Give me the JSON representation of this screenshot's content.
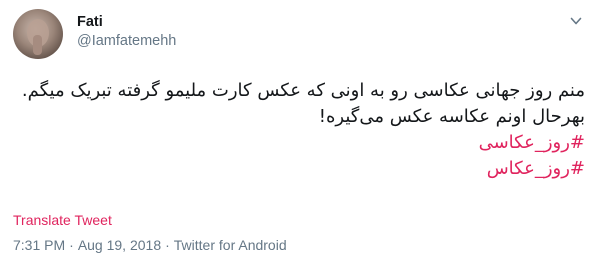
{
  "tweet": {
    "display_name": "Fati",
    "handle": "@Iamfatemehh",
    "text_lines": [
      "منم روز جهانی عکاسی رو به اونی که عکس کارت ملیمو گرفته تبریک میگم.",
      "بهرحال اونم عکاسه عکس می‌گیره!"
    ],
    "hashtags": [
      "#روز_عکاسی",
      "#روز_عکاس"
    ],
    "translate_label": "Translate Tweet",
    "time": "7:31 PM",
    "date": "Aug 19, 2018",
    "separator": "·",
    "source": "Twitter for Android",
    "hashtag_color": "#e0245e",
    "secondary_color": "#657786"
  },
  "icons": {
    "avatar": "profile-photo",
    "menu": "chevron-down-icon"
  }
}
